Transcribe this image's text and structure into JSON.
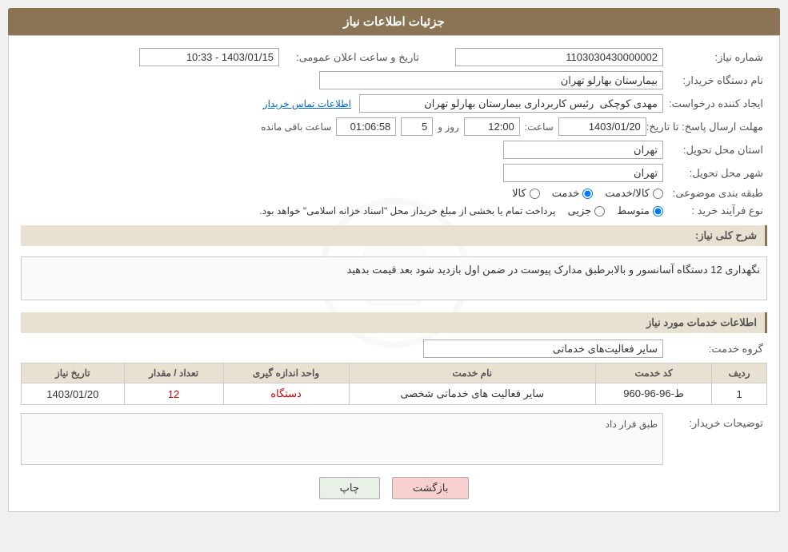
{
  "header": {
    "title": "جزئیات اطلاعات نیاز"
  },
  "form": {
    "need_number_label": "شماره نیاز:",
    "need_number_value": "1103030430000002",
    "announcement_date_label": "تاریخ و ساعت اعلان عمومی:",
    "announcement_date_value": "1403/01/15 - 10:33",
    "buyer_org_label": "نام دستگاه خریدار:",
    "buyer_org_value": "بیمارستان بهارلو تهران",
    "creator_label": "ایجاد کننده درخواست:",
    "creator_value": "مهدی کوچکی  رئیس کاربرداری بیمارستان بهارلو تهران",
    "contact_link": "اطلاعات تماس خریدار",
    "deadline_label": "مهلت ارسال پاسخ: تا تاریخ:",
    "deadline_date_value": "1403/01/20",
    "deadline_time_label": "ساعت:",
    "deadline_time_value": "12:00",
    "deadline_day_label": "روز و",
    "deadline_day_value": "5",
    "deadline_remaining_label": "ساعت باقی مانده",
    "deadline_remaining_value": "01:06:58",
    "province_label": "استان محل تحویل:",
    "province_value": "تهران",
    "city_label": "شهر محل تحویل:",
    "city_value": "تهران",
    "category_label": "طبقه بندی موضوعی:",
    "category_options": [
      {
        "label": "کالا",
        "selected": false
      },
      {
        "label": "خدمت",
        "selected": true
      },
      {
        "label": "کالا/خدمت",
        "selected": false
      }
    ],
    "purchase_type_label": "نوع فرآیند خرید :",
    "purchase_type_options": [
      {
        "label": "جزیی",
        "selected": false
      },
      {
        "label": "متوسط",
        "selected": true
      },
      {
        "label": "",
        "selected": false
      }
    ],
    "purchase_note": "پرداخت تمام یا بخشی از مبلغ خریداز محل \"اسناد خزانه اسلامی\" خواهد بود.",
    "description_label": "شرح کلی نیاز:",
    "description_value": "نگهداری 12 دستگاه آسانسور  و  بالابرطبق مدارک پیوست در ضمن اول بازدید شود بعد قیمت بدهید",
    "services_section_label": "اطلاعات خدمات مورد نیاز",
    "service_group_label": "گروه خدمت:",
    "service_group_value": "سایر فعالیت‌های خدماتی",
    "table": {
      "columns": [
        "ردیف",
        "کد خدمت",
        "نام خدمت",
        "واحد اندازه گیری",
        "تعداد / مقدار",
        "تاریخ نیاز"
      ],
      "rows": [
        {
          "row_num": "1",
          "service_code": "ط-96-96-960",
          "service_name": "سایر فعالیت های خدماتی شخصی",
          "unit": "دستگاه",
          "quantity": "12",
          "date": "1403/01/20"
        }
      ]
    },
    "buyer_notes_label": "توضیحات خریدار:",
    "buyer_notes_value": "طبق قرار داد"
  },
  "buttons": {
    "print_label": "چاپ",
    "back_label": "بازگشت"
  }
}
